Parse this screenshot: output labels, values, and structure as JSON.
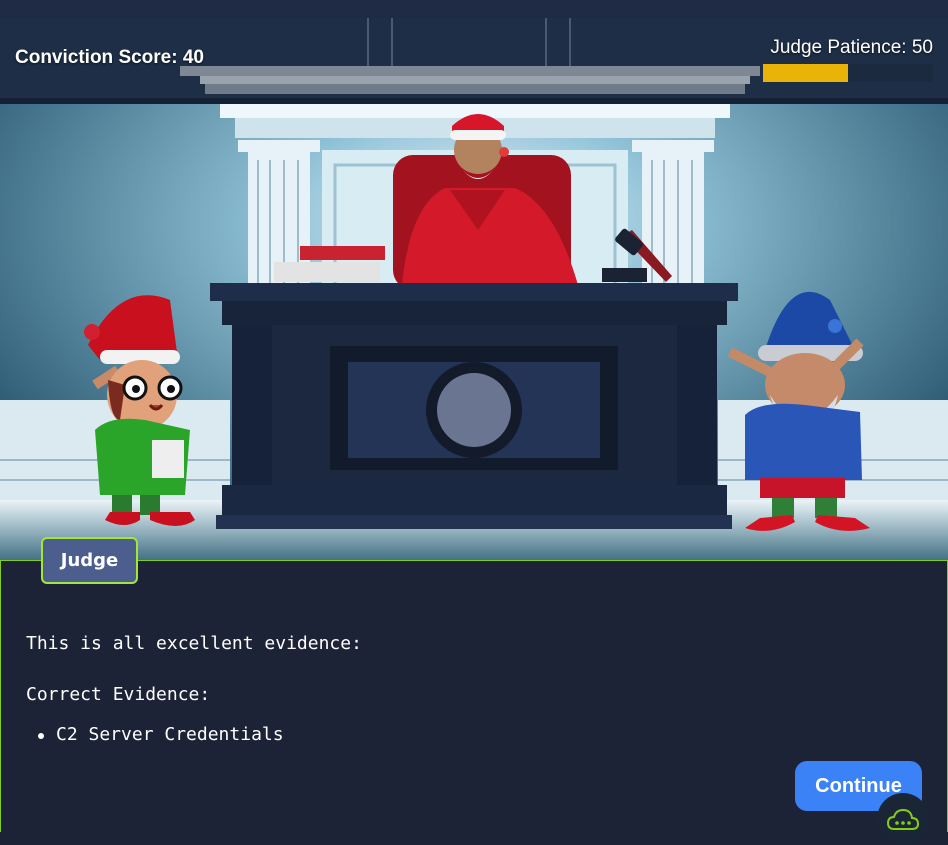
{
  "hud": {
    "conviction_label": "Conviction Score: 40",
    "patience_label": "Judge Patience: 50",
    "patience_level": 0.5,
    "patience_color": "#eab308"
  },
  "dialog": {
    "speaker": "Judge",
    "line1": "This is all excellent evidence:",
    "line2": "Correct Evidence:",
    "evidence": [
      "C2 Server Credentials"
    ],
    "continue_label": "Continue",
    "accent_color": "#84cc16"
  },
  "icons": {
    "chat": "chat-cloud-icon"
  }
}
